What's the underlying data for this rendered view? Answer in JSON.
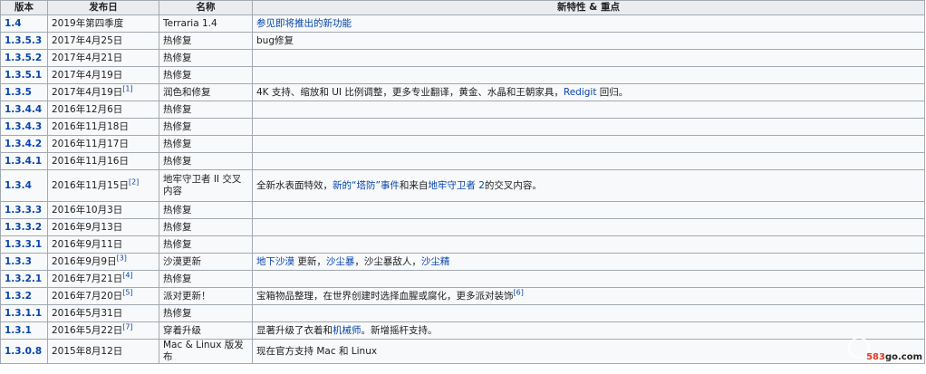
{
  "table": {
    "headers": [
      "版本",
      "发布日",
      "名称",
      "新特性 & 重点"
    ],
    "rows": [
      {
        "version": "1.4",
        "date": "2019年第四季度",
        "name": "Terraria 1.4",
        "notes": [
          {
            "t": "参见即将推出的新功能",
            "link": true
          }
        ]
      },
      {
        "version": "1.3.5.3",
        "date": "2017年4月25日",
        "name": "热修复",
        "notes": [
          {
            "t": "bug修复"
          }
        ]
      },
      {
        "version": "1.3.5.2",
        "date": "2017年4月21日",
        "name": "热修复",
        "notes": []
      },
      {
        "version": "1.3.5.1",
        "date": "2017年4月19日",
        "name": "热修复",
        "notes": []
      },
      {
        "version": "1.3.5",
        "date": "2017年4月19日",
        "ref": "[1]",
        "name": "润色和修复",
        "notes": [
          {
            "t": "4K 支持、缩放和 UI 比例调整，更多专业翻译，黄金、水晶和王朝家具，"
          },
          {
            "t": "Redigit",
            "link": true
          },
          {
            "t": " 回归。"
          }
        ]
      },
      {
        "version": "1.3.4.4",
        "date": "2016年12月6日",
        "name": "热修复",
        "notes": []
      },
      {
        "version": "1.3.4.3",
        "date": "2016年11月18日",
        "name": "热修复",
        "notes": []
      },
      {
        "version": "1.3.4.2",
        "date": "2016年11月17日",
        "name": "热修复",
        "notes": []
      },
      {
        "version": "1.3.4.1",
        "date": "2016年11月16日",
        "name": "热修复",
        "notes": []
      },
      {
        "version": "1.3.4",
        "date": "2016年11月15日",
        "ref": "[2]",
        "name": "地牢守卫者 II 交叉内容",
        "tall": true,
        "notes": [
          {
            "t": "全新水表面特效，"
          },
          {
            "t": "新的“塔防”事件",
            "link": true
          },
          {
            "t": "和来自"
          },
          {
            "t": "地牢守卫者 2",
            "link": true
          },
          {
            "t": "的交叉内容。"
          }
        ]
      },
      {
        "version": "1.3.3.3",
        "date": "2016年10月3日",
        "name": "热修复",
        "notes": []
      },
      {
        "version": "1.3.3.2",
        "date": "2016年9月13日",
        "name": "热修复",
        "notes": []
      },
      {
        "version": "1.3.3.1",
        "date": "2016年9月11日",
        "name": "热修复",
        "notes": []
      },
      {
        "version": "1.3.3",
        "date": "2016年9月9日",
        "ref": "[3]",
        "name": "沙漠更新",
        "notes": [
          {
            "t": "地下沙漠",
            "link": true
          },
          {
            "t": " 更新，"
          },
          {
            "t": "沙尘暴",
            "link": true
          },
          {
            "t": "，沙尘暴敌人，"
          },
          {
            "t": "沙尘精",
            "link": true
          }
        ]
      },
      {
        "version": "1.3.2.1",
        "date": "2016年7月21日",
        "ref": "[4]",
        "name": "热修复",
        "notes": []
      },
      {
        "version": "1.3.2",
        "date": "2016年7月20日",
        "ref": "[5]",
        "name": "派对更新！",
        "notes": [
          {
            "t": "宝箱物品整理，在世界创建时选择血腥或腐化，更多派对装饰"
          },
          {
            "t": "[6]",
            "sup": true
          }
        ]
      },
      {
        "version": "1.3.1.1",
        "date": "2016年5月31日",
        "name": "热修复",
        "notes": []
      },
      {
        "version": "1.3.1",
        "date": "2016年5月22日",
        "ref": "[7]",
        "name": "穿着升级",
        "notes": [
          {
            "t": "显著升级了衣着和"
          },
          {
            "t": "机械师",
            "link": true
          },
          {
            "t": "。新增摇杆支持。"
          }
        ]
      },
      {
        "version": "1.3.0.8",
        "date": "2015年8月12日",
        "name": "Mac & Linux 版发布",
        "notes": [
          {
            "t": "现在官方支持 Mac 和 Linux"
          }
        ]
      }
    ]
  },
  "watermark": {
    "brand": "583",
    "rest": "go.com"
  }
}
